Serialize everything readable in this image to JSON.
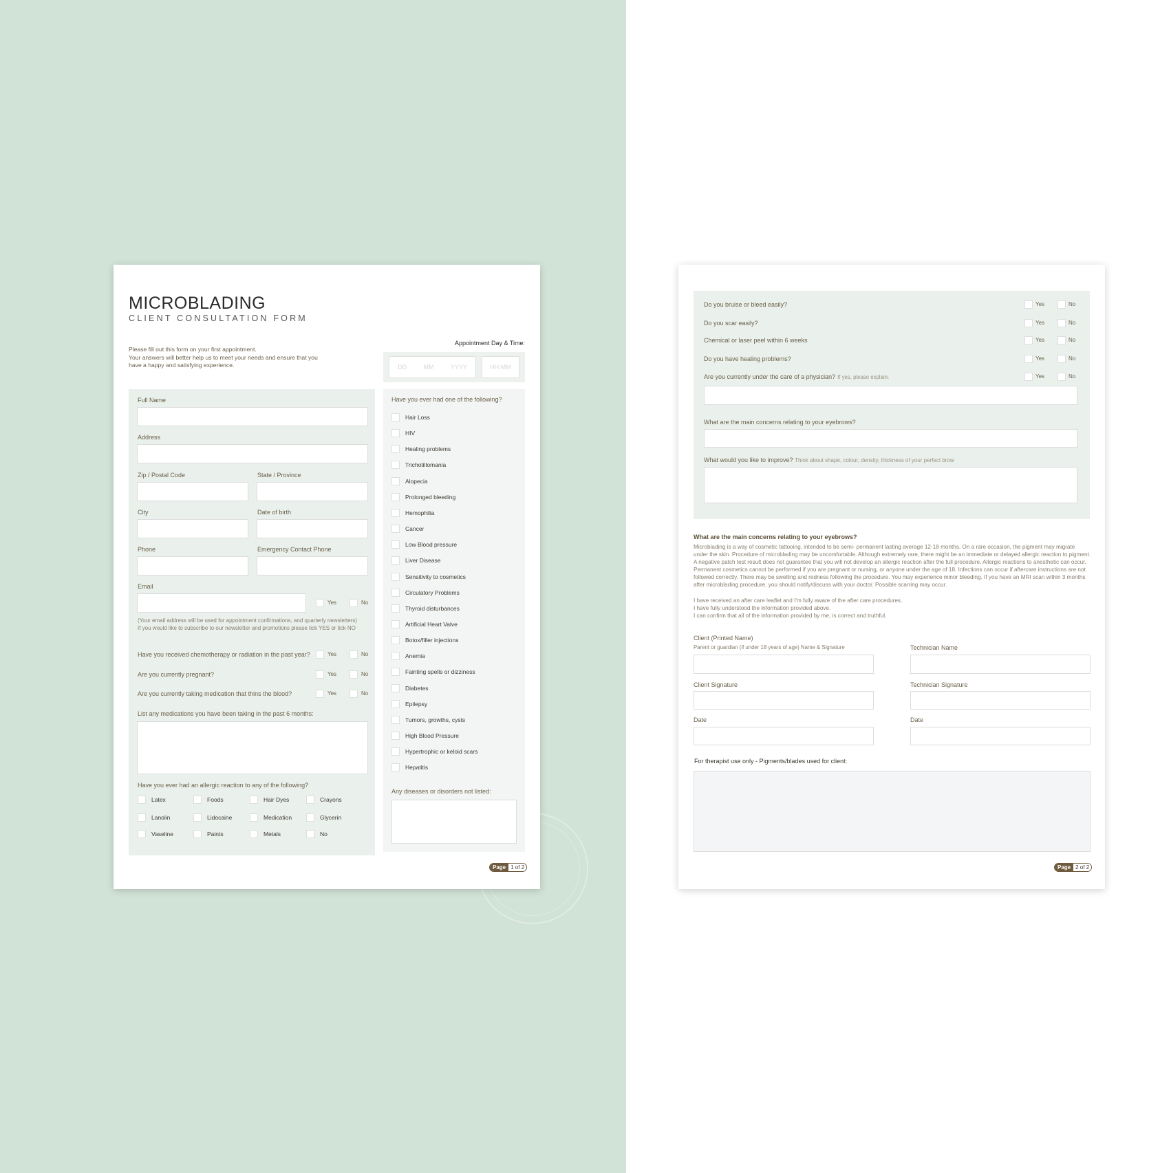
{
  "page1": {
    "title": "MICROBLADING",
    "subtitle": "CLIENT CONSULTATION FORM",
    "intro": [
      "Please fill out this form on your first appointment.",
      "Your answers will better help us to meet your needs and ensure that you",
      "have a happy and satisfying experience."
    ],
    "appointment": {
      "label": "Appointment Day & Time:",
      "dd_placeholder": "DD",
      "mm_placeholder": "MM",
      "yyyy_placeholder": "YYYY",
      "time_placeholder": "HH:MM"
    },
    "fields": {
      "full_name": "Full Name",
      "address": "Address",
      "zip": "Zip / Postal Code",
      "state": "State / Province",
      "city": "City",
      "dob": "Date of birth",
      "phone": "Phone",
      "emergency_phone": "Emergency Contact Phone",
      "email": "Email"
    },
    "email_note": [
      "(Your email address will be used for appointment confirmations, and quarterly newsletters)",
      "If you would like to subscribe to our newsletter and promotions please tick YES or tick NO"
    ],
    "yes_label": "Yes",
    "no_label": "No",
    "questions": [
      "Have you received chemotherapy or radiation in the past year?",
      "Are you currently pregnant?",
      "Are you currently taking medication that thins the blood?"
    ],
    "medications_label": "List any medications you have been taking in the past 6 months:",
    "allergy_label": "Have you ever had an allergic reaction to any of the following?",
    "allergies": [
      [
        "Latex",
        "Foods",
        "Hair Dyes",
        "Crayons"
      ],
      [
        "Lanolin",
        "Lidocaine",
        "Medication",
        "Glycerin"
      ],
      [
        "Vaseline",
        "Paints",
        "Metals",
        "No"
      ]
    ],
    "conditions_label": "Have you ever had one of the following?",
    "conditions": [
      "Hair Loss",
      "HIV",
      "Healing problems",
      "Trichotillomania",
      "Alopecia",
      "Prolonged bleeding",
      "Hemophilia",
      "Cancer",
      "Low Blood pressure",
      "Liver Disease",
      "Sensitivity to cosmetics",
      "Circulatory Problems",
      "Thyroid disturbances",
      "Artificial Heart Valve",
      "Botox/filler injections",
      "Anemia",
      "Fainting spells or dizziness",
      "Diabetes",
      "Epilepsy",
      "Tumors, growths, cysts",
      "High Blood Pressure",
      "Hypertrophic or keloid scars",
      "Hepatitis"
    ],
    "not_listed_label": "Any diseases or disorders not listed:",
    "page_badge": {
      "word": "Page",
      "number": "1 of 2"
    }
  },
  "page2": {
    "questions": [
      {
        "text": "Do you bruise or bleed easily?",
        "hint": ""
      },
      {
        "text": "Do you scar easily?",
        "hint": ""
      },
      {
        "text": "Chemical or laser peel within 6 weeks",
        "hint": ""
      },
      {
        "text": "Do you have healing problems?",
        "hint": ""
      },
      {
        "text": "Are you currently under the care of a physician?",
        "hint": "If yes, please explain:"
      }
    ],
    "yes_label": "Yes",
    "no_label": "No",
    "concerns_label": "What are the main concerns relating to your eyebrows?",
    "improve_label": "What would you like to improve?",
    "improve_hint": "Think about shape, colour, density, thickness of your perfect brow",
    "info_heading": "What are the main concerns relating to your eyebrows?",
    "info_lines": [
      "Microblading is a way of cosmetic tattooing, intended to be semi- permanent lasting average 12-18 months. On a rare occasion, the pigment may migrate",
      "under the skin. Procedure of microblading may be uncomfortable. Although extremely rare, there might be an immediate or delayed allergic reaction to pigment.",
      "A negative patch test result does not guarantee that you will not develop an allergic reaction after the full procedure. Allergic reactions to anesthetic can occur.",
      "Permanent cosmetics cannot be performed if you are pregnant or nursing, or anyone under the age of 18. Infections can occur if aftercare instructions are not",
      "followed correctly. There may be swelling and redness following the procedure. You may experience minor bleeding. If you have an MRI scan within 3 months",
      "after microblading procedure, you should notify/discuss with your doctor. Possible scarring may occur."
    ],
    "consent_lines": [
      "I have received an after care leaflet and I'm fully aware of the after care procedures.",
      "I have fully understood the information provided above.",
      "I can confirm that all of the information provided by me, is correct and truthful."
    ],
    "client_printed_name": "Client (Printed Name)",
    "guardian_note": "Parent or guardian (if under 18 years of age) Name & Signature",
    "technician_name": "Technician Name",
    "client_signature": "Client Signature",
    "technician_signature": "Technician Signature",
    "date_label": "Date",
    "therapist_label": "For therapist use only -  Pigments/blades used for client:",
    "page_badge": {
      "word": "Page",
      "number": "2 of 2"
    }
  }
}
